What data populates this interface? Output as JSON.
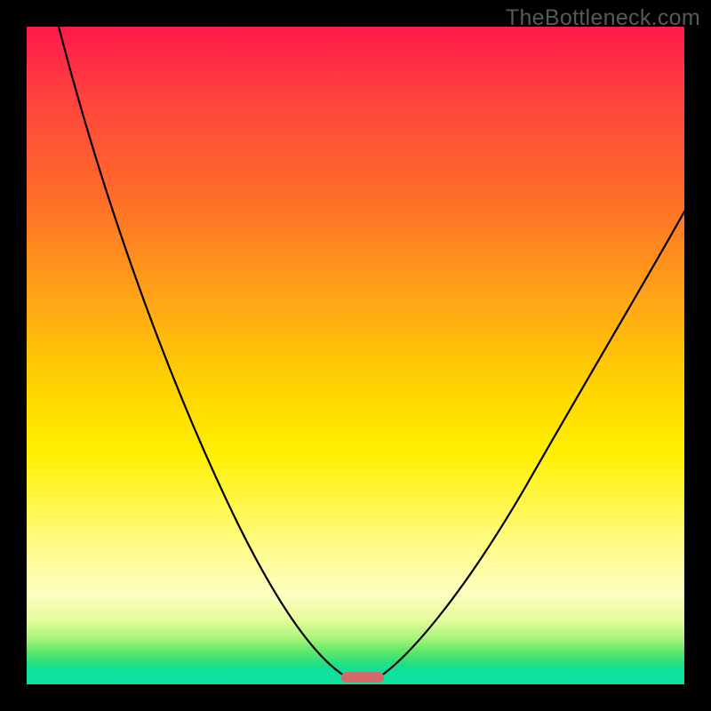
{
  "watermark": "TheBottleneck.com",
  "chart_data": {
    "type": "line",
    "title": "",
    "xlabel": "",
    "ylabel": "",
    "xlim": [
      0,
      100
    ],
    "ylim": [
      0,
      100
    ],
    "background_gradient": {
      "orientation": "vertical",
      "stops": [
        {
          "pos": 0,
          "color": "#ff1a4b"
        },
        {
          "pos": 25,
          "color": "#ff6a2a"
        },
        {
          "pos": 55,
          "color": "#ffd400"
        },
        {
          "pos": 86,
          "color": "#fdfec0"
        },
        {
          "pos": 97,
          "color": "#1fdf85"
        },
        {
          "pos": 100,
          "color": "#0fdf9f"
        }
      ]
    },
    "series": [
      {
        "name": "left-branch",
        "x": [
          0,
          5,
          10,
          15,
          20,
          25,
          30,
          35,
          40,
          45,
          49
        ],
        "y": [
          100,
          90,
          79,
          68,
          57,
          46,
          35,
          25,
          15,
          6,
          1
        ]
      },
      {
        "name": "right-branch",
        "x": [
          53,
          58,
          63,
          68,
          73,
          78,
          83,
          88,
          93,
          98,
          100
        ],
        "y": [
          1,
          9,
          18,
          27,
          36,
          44,
          52,
          59,
          65,
          70,
          72
        ]
      }
    ],
    "annotations": [
      {
        "name": "bottom-marker",
        "shape": "rounded-rect",
        "x_center": 51,
        "y_center": 0.7,
        "width": 6,
        "height": 1.4,
        "color": "#d46a6a"
      }
    ]
  }
}
